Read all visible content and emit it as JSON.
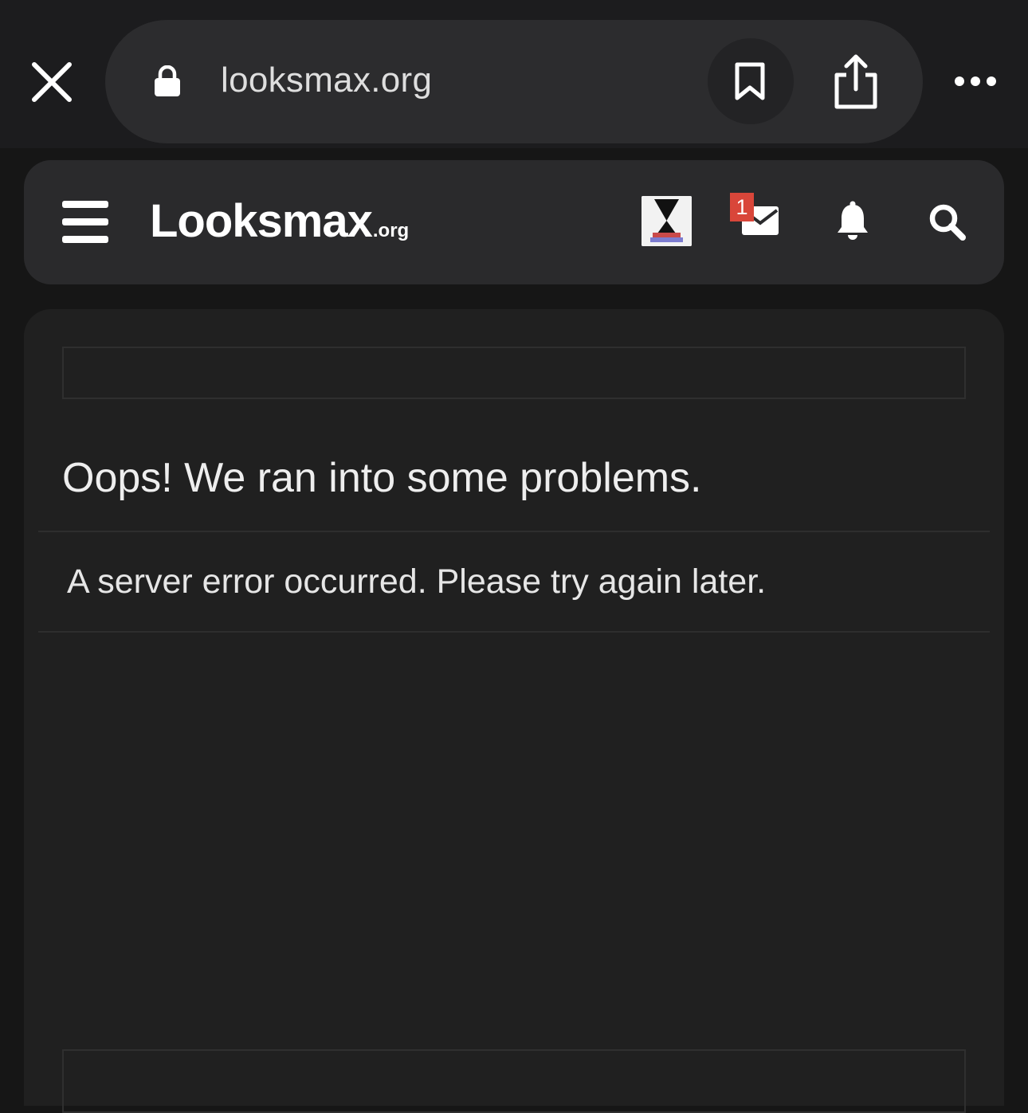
{
  "browser": {
    "url": "looksmax.org",
    "icons": [
      "close-icon",
      "lock-icon",
      "bookmark-icon",
      "share-icon",
      "more-icon"
    ]
  },
  "header": {
    "logo_main": "Looksmax",
    "logo_tld": ".org",
    "mail_badge": "1",
    "icons": [
      "menu-icon",
      "avatar",
      "mail-icon",
      "bell-icon",
      "search-icon"
    ]
  },
  "content": {
    "title": "Oops! We ran into some problems.",
    "message": "A server error occurred. Please try again later."
  },
  "colors": {
    "background": "#161616",
    "card": "#202020",
    "header": "#2a2a2c",
    "badge": "#d9463a"
  }
}
